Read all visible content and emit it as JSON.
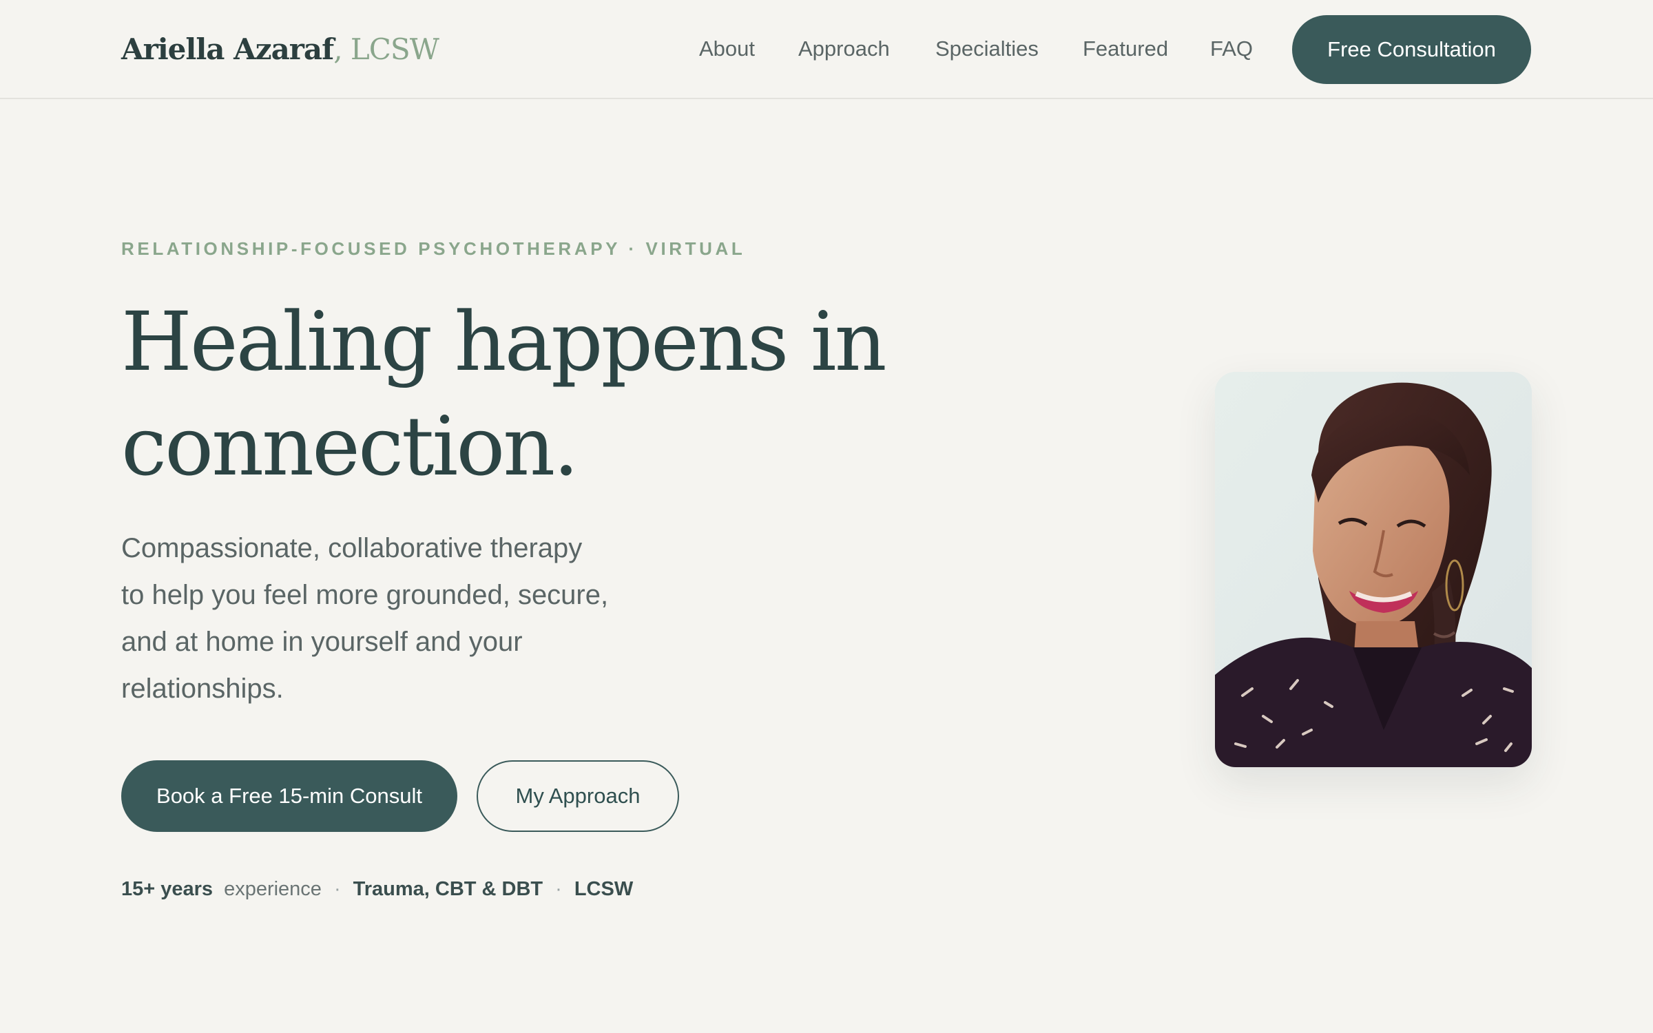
{
  "header": {
    "logo_name": "Ariella Azaraf",
    "logo_credential": ", LCSW",
    "nav": [
      "About",
      "Approach",
      "Specialties",
      "Featured",
      "FAQ"
    ],
    "cta_label": "Free Consultation"
  },
  "hero": {
    "eyebrow": "RELATIONSHIP-FOCUSED PSYCHOTHERAPY · VIRTUAL",
    "title_lines": [
      "Healing happens in",
      "connection."
    ],
    "lede_lines": [
      "Compassionate, collaborative therapy",
      "to help you feel more grounded, secure,",
      "and at home in yourself and your",
      "relationships."
    ],
    "primary_cta": "Book a Free 15-min Consult",
    "secondary_cta": "My Approach"
  },
  "credentials": {
    "years": "15+ years",
    "years_suffix": "experience",
    "separator": "·",
    "specialty": "Trauma, CBT & DBT",
    "license": "LCSW"
  },
  "colors": {
    "background": "#f5f4f0",
    "primary": "#3a5a5a",
    "heading": "#2c4444",
    "accent": "#8aa68c",
    "body_text": "#5a6565"
  }
}
